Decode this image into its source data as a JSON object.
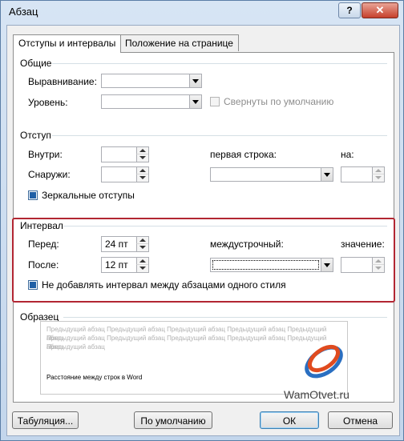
{
  "window": {
    "title": "Абзац",
    "help_label": "?",
    "close_label": "✕"
  },
  "tabs": [
    {
      "label": "Отступы и интервалы",
      "active": true
    },
    {
      "label": "Положение на странице",
      "active": false
    }
  ],
  "general": {
    "heading": "Общие",
    "alignment_label": "Выравнивание:",
    "alignment_value": "",
    "level_label": "Уровень:",
    "level_value": "",
    "collapsed_label": "Свернуты по умолчанию"
  },
  "indent": {
    "heading": "Отступ",
    "inside_label": "Внутри:",
    "inside_value": "",
    "outside_label": "Снаружи:",
    "outside_value": "",
    "first_line_label": "первая строка:",
    "first_line_value": "",
    "by_label": "на:",
    "by_value": "",
    "mirror_label": "Зеркальные отступы",
    "mirror_checked": true
  },
  "spacing": {
    "heading": "Интервал",
    "before_label": "Перед:",
    "before_value": "24 пт",
    "after_label": "После:",
    "after_value": "12 пт",
    "line_spacing_label": "междустрочный:",
    "line_spacing_value": "",
    "at_label": "значение:",
    "at_value": "",
    "dont_add_label": "Не добавлять интервал между абзацами одного стиля",
    "dont_add_checked": true
  },
  "preview": {
    "heading": "Образец",
    "prev_para_lines": [
      "Предыдущий абзац Предыдущий абзац Предыдущий абзац Предыдущий абзац Предыдущий абзац",
      "Предыдущий абзац Предыдущий абзац Предыдущий абзац Предыдущий абзац Предыдущий абзац",
      "Предыдущий абзац"
    ],
    "sample_text": "Расстояние между строк в Word"
  },
  "watermark": {
    "text": "WamOtvet.ru"
  },
  "buttons": {
    "tabs": "Табуляция...",
    "default": "По умолчанию",
    "ok": "ОК",
    "cancel": "Отмена"
  },
  "colors": {
    "highlight_box": "#b22632",
    "accent": "#1f5fa6"
  }
}
